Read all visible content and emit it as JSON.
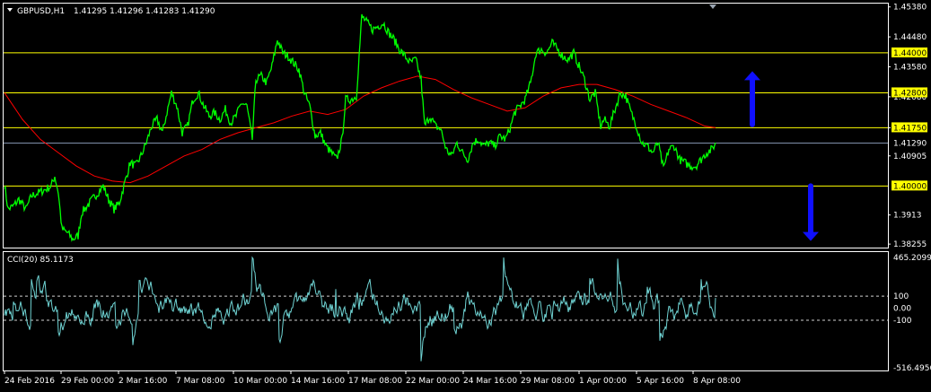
{
  "header": {
    "symbol": "GBPUSD,H1",
    "ohlc": "1.41295 1.41296 1.41283 1.41290"
  },
  "colors": {
    "background": "#000000",
    "price": "#00ff00",
    "ma": "#ff0000",
    "level": "#ffff00",
    "current_line": "#7f8faa",
    "cci": "#6fd3d3",
    "arrow": "#1010ff",
    "axis": "#ffffff"
  },
  "chart_data": [
    {
      "type": "line",
      "title": "GBPUSD,H1",
      "ylim": [
        1.3815,
        1.4548
      ],
      "x_ticks": [
        "24 Feb 2016",
        "29 Feb 00:00",
        "2 Mar 16:00",
        "7 Mar 08:00",
        "10 Mar 00:00",
        "14 Mar 16:00",
        "17 Mar 08:00",
        "22 Mar 00:00",
        "24 Mar 16:00",
        "29 Mar 08:00",
        "1 Apr 00:00",
        "5 Apr 16:00",
        "8 Apr 08:00"
      ],
      "y_ticks": [
        1.4538,
        1.4448,
        1.4358,
        1.4268,
        1.4175,
        1.40905,
        1.3913,
        1.38255
      ],
      "levels": [
        {
          "label": "1.44000",
          "value": 1.44
        },
        {
          "label": "1.42800",
          "value": 1.428
        },
        {
          "label": "1.41750",
          "value": 1.4175
        },
        {
          "label": "1.40000",
          "value": 1.4
        }
      ],
      "current_price": {
        "label": "1.41290",
        "value": 1.4129
      },
      "series": [
        {
          "key": "price",
          "points": [
            [
              0,
              1.4005
            ],
            [
              4,
              1.393
            ],
            [
              10,
              1.394
            ],
            [
              16,
              1.396
            ],
            [
              24,
              1.393
            ],
            [
              30,
              1.397
            ],
            [
              38,
              1.398
            ],
            [
              46,
              1.399
            ],
            [
              52,
              1.4
            ],
            [
              56,
              1.403
            ],
            [
              60,
              1.398
            ],
            [
              64,
              1.387
            ],
            [
              70,
              1.386
            ],
            [
              76,
              1.384
            ],
            [
              82,
              1.385
            ],
            [
              86,
              1.392
            ],
            [
              92,
              1.394
            ],
            [
              98,
              1.396
            ],
            [
              104,
              1.398
            ],
            [
              110,
              1.4
            ],
            [
              116,
              1.396
            ],
            [
              122,
              1.393
            ],
            [
              128,
              1.395
            ],
            [
              134,
              1.401
            ],
            [
              140,
              1.407
            ],
            [
              146,
              1.406
            ],
            [
              152,
              1.409
            ],
            [
              158,
              1.413
            ],
            [
              164,
              1.418
            ],
            [
              170,
              1.42
            ],
            [
              176,
              1.416
            ],
            [
              180,
              1.421
            ],
            [
              186,
              1.428
            ],
            [
              192,
              1.424
            ],
            [
              198,
              1.416
            ],
            [
              204,
              1.418
            ],
            [
              210,
              1.426
            ],
            [
              216,
              1.428
            ],
            [
              222,
              1.424
            ],
            [
              228,
              1.421
            ],
            [
              234,
              1.422
            ],
            [
              240,
              1.42
            ],
            [
              246,
              1.423
            ],
            [
              252,
              1.419
            ],
            [
              258,
              1.421
            ],
            [
              264,
              1.425
            ],
            [
              270,
              1.424
            ],
            [
              276,
              1.414
            ],
            [
              280,
              1.432
            ],
            [
              286,
              1.433
            ],
            [
              292,
              1.431
            ],
            [
              298,
              1.436
            ],
            [
              304,
              1.444
            ],
            [
              310,
              1.44
            ],
            [
              316,
              1.439
            ],
            [
              322,
              1.437
            ],
            [
              328,
              1.435
            ],
            [
              334,
              1.428
            ],
            [
              340,
              1.424
            ],
            [
              346,
              1.415
            ],
            [
              352,
              1.416
            ],
            [
              358,
              1.412
            ],
            [
              364,
              1.41
            ],
            [
              370,
              1.408
            ],
            [
              376,
              1.414
            ],
            [
              380,
              1.426
            ],
            [
              386,
              1.426
            ],
            [
              392,
              1.427
            ],
            [
              398,
              1.451
            ],
            [
              404,
              1.449
            ],
            [
              410,
              1.447
            ],
            [
              416,
              1.448
            ],
            [
              422,
              1.449
            ],
            [
              428,
              1.446
            ],
            [
              434,
              1.444
            ],
            [
              440,
              1.441
            ],
            [
              446,
              1.439
            ],
            [
              452,
              1.437
            ],
            [
              458,
              1.438
            ],
            [
              464,
              1.432
            ],
            [
              468,
              1.418
            ],
            [
              474,
              1.421
            ],
            [
              480,
              1.418
            ],
            [
              486,
              1.417
            ],
            [
              492,
              1.411
            ],
            [
              498,
              1.409
            ],
            [
              504,
              1.413
            ],
            [
              510,
              1.41
            ],
            [
              516,
              1.408
            ],
            [
              522,
              1.413
            ],
            [
              528,
              1.414
            ],
            [
              534,
              1.412
            ],
            [
              540,
              1.413
            ],
            [
              546,
              1.412
            ],
            [
              552,
              1.415
            ],
            [
              558,
              1.414
            ],
            [
              564,
              1.418
            ],
            [
              568,
              1.422
            ],
            [
              574,
              1.424
            ],
            [
              580,
              1.426
            ],
            [
              586,
              1.431
            ],
            [
              592,
              1.44
            ],
            [
              598,
              1.441
            ],
            [
              604,
              1.44
            ],
            [
              610,
              1.443
            ],
            [
              616,
              1.441
            ],
            [
              622,
              1.439
            ],
            [
              628,
              1.438
            ],
            [
              634,
              1.44
            ],
            [
              640,
              1.436
            ],
            [
              646,
              1.432
            ],
            [
              652,
              1.426
            ],
            [
              658,
              1.428
            ],
            [
              664,
              1.418
            ],
            [
              668,
              1.42
            ],
            [
              674,
              1.418
            ],
            [
              680,
              1.423
            ],
            [
              686,
              1.428
            ],
            [
              692,
              1.427
            ],
            [
              698,
              1.422
            ],
            [
              704,
              1.418
            ],
            [
              710,
              1.413
            ],
            [
              716,
              1.412
            ],
            [
              722,
              1.41
            ],
            [
              728,
              1.413
            ],
            [
              734,
              1.405
            ],
            [
              740,
              1.411
            ],
            [
              746,
              1.412
            ],
            [
              752,
              1.408
            ],
            [
              758,
              1.407
            ],
            [
              764,
              1.406
            ],
            [
              770,
              1.406
            ],
            [
              776,
              1.408
            ],
            [
              782,
              1.41
            ],
            [
              788,
              1.411
            ],
            [
              792,
              1.413
            ]
          ]
        },
        {
          "key": "ma",
          "points": [
            [
              0,
              1.428
            ],
            [
              20,
              1.42
            ],
            [
              40,
              1.414
            ],
            [
              60,
              1.41
            ],
            [
              80,
              1.406
            ],
            [
              100,
              1.403
            ],
            [
              120,
              1.4015
            ],
            [
              140,
              1.401
            ],
            [
              160,
              1.403
            ],
            [
              180,
              1.406
            ],
            [
              200,
              1.409
            ],
            [
              220,
              1.411
            ],
            [
              240,
              1.414
            ],
            [
              260,
              1.416
            ],
            [
              280,
              1.4175
            ],
            [
              300,
              1.419
            ],
            [
              320,
              1.421
            ],
            [
              340,
              1.4225
            ],
            [
              360,
              1.4215
            ],
            [
              380,
              1.423
            ],
            [
              400,
              1.427
            ],
            [
              420,
              1.4295
            ],
            [
              440,
              1.4315
            ],
            [
              460,
              1.433
            ],
            [
              480,
              1.432
            ],
            [
              500,
              1.429
            ],
            [
              520,
              1.4265
            ],
            [
              540,
              1.4245
            ],
            [
              560,
              1.4225
            ],
            [
              580,
              1.4235
            ],
            [
              600,
              1.427
            ],
            [
              620,
              1.4295
            ],
            [
              640,
              1.4305
            ],
            [
              660,
              1.4305
            ],
            [
              680,
              1.429
            ],
            [
              700,
              1.427
            ],
            [
              720,
              1.4245
            ],
            [
              740,
              1.4225
            ],
            [
              760,
              1.4205
            ],
            [
              780,
              1.418
            ],
            [
              792,
              1.4175
            ]
          ]
        }
      ]
    },
    {
      "type": "line",
      "title": "CCI(20) 85.1173",
      "ylim": [
        -516.4956,
        465.2099
      ],
      "y_ticks": [
        {
          "label": "465.2099",
          "value": 465.2099
        },
        {
          "label": "100",
          "value": 100
        },
        {
          "label": "0.00",
          "value": 0
        },
        {
          "label": "-100",
          "value": -100
        },
        {
          "label": "-516.4956",
          "value": -516.4956
        }
      ],
      "levels": [
        100,
        -100
      ],
      "series": [
        {
          "key": "cci",
          "name": "CCI(20) 85.1173",
          "seed": 17,
          "length": 792,
          "spikes": [
            [
              30,
              240
            ],
            [
              60,
              -200
            ],
            [
              150,
              230
            ],
            [
              276,
              420
            ],
            [
              306,
              -260
            ],
            [
              344,
              230
            ],
            [
              464,
              -440
            ],
            [
              556,
              420
            ],
            [
              683,
              410
            ],
            [
              730,
              -270
            ],
            [
              776,
              240
            ],
            [
              792,
              85
            ]
          ]
        }
      ]
    }
  ],
  "indicator": {
    "label": "CCI(20) 85.1173"
  },
  "arrows": [
    {
      "name": "up-arrow",
      "direction": "up",
      "x": 838,
      "price_from": 1.4185,
      "price_to": 1.4345
    },
    {
      "name": "down-arrow",
      "direction": "down",
      "x": 903,
      "price_from": 1.4,
      "price_to": 1.3835
    }
  ]
}
